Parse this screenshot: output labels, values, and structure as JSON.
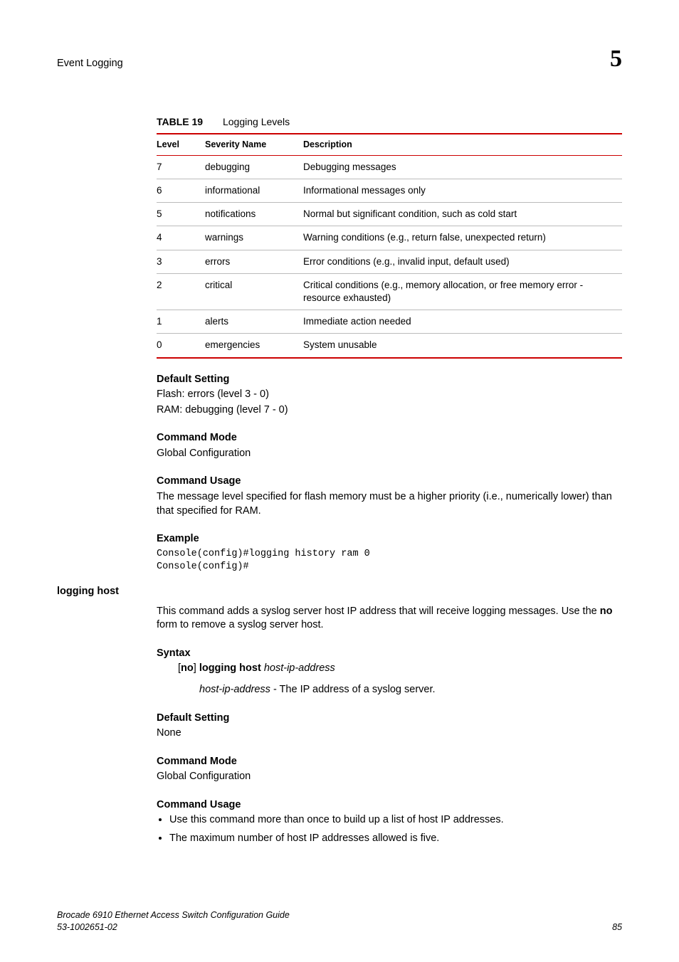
{
  "header": {
    "section_title": "Event Logging",
    "chapter_number": "5"
  },
  "table": {
    "label": "TABLE 19",
    "title": "Logging Levels",
    "columns": [
      "Level",
      "Severity Name",
      "Description"
    ],
    "rows": [
      {
        "level": "7",
        "name": "debugging",
        "desc": "Debugging messages"
      },
      {
        "level": "6",
        "name": "informational",
        "desc": "Informational messages only"
      },
      {
        "level": "5",
        "name": "notifications",
        "desc": "Normal but significant condition, such as cold start"
      },
      {
        "level": "4",
        "name": "warnings",
        "desc": "Warning conditions (e.g., return false, unexpected return)"
      },
      {
        "level": "3",
        "name": "errors",
        "desc": "Error conditions (e.g., invalid input, default used)"
      },
      {
        "level": "2",
        "name": "critical",
        "desc": "Critical conditions (e.g., memory allocation, or free memory error - resource exhausted)"
      },
      {
        "level": "1",
        "name": "alerts",
        "desc": "Immediate action needed"
      },
      {
        "level": "0",
        "name": "emergencies",
        "desc": "System unusable"
      }
    ]
  },
  "section1": {
    "default_setting_heading": "Default Setting",
    "default_setting_line1": "Flash: errors (level 3 - 0)",
    "default_setting_line2": "RAM: debugging (level 7 - 0)",
    "command_mode_heading": "Command Mode",
    "command_mode_text": "Global Configuration",
    "command_usage_heading": "Command Usage",
    "command_usage_text": "The message level specified for flash memory must be a higher priority (i.e., numerically lower) than that specified for RAM.",
    "example_heading": "Example",
    "example_code": "Console(config)#logging history ram 0\nConsole(config)#"
  },
  "section2": {
    "command_name": "logging host",
    "intro_part1": "This command adds a syslog server host IP address that will receive logging messages. Use the ",
    "intro_bold": "no",
    "intro_part2": " form to remove a syslog server host.",
    "syntax_heading": "Syntax",
    "syntax_bracket_open": "[",
    "syntax_no": "no",
    "syntax_bracket_close": "] ",
    "syntax_cmd": "logging host",
    "syntax_arg_name": "host-ip-address",
    "syntax_arg_desc": " - The IP address of a syslog server.",
    "default_setting_heading": "Default Setting",
    "default_setting_text": "None",
    "command_mode_heading": "Command Mode",
    "command_mode_text": "Global Configuration",
    "command_usage_heading": "Command Usage",
    "usage_items": [
      "Use this command more than once to build up a list of host IP addresses.",
      "The maximum number of host IP addresses allowed is five."
    ]
  },
  "footer": {
    "line1": "Brocade 6910 Ethernet Access Switch Configuration Guide",
    "line2": "53-1002651-02",
    "page": "85"
  }
}
